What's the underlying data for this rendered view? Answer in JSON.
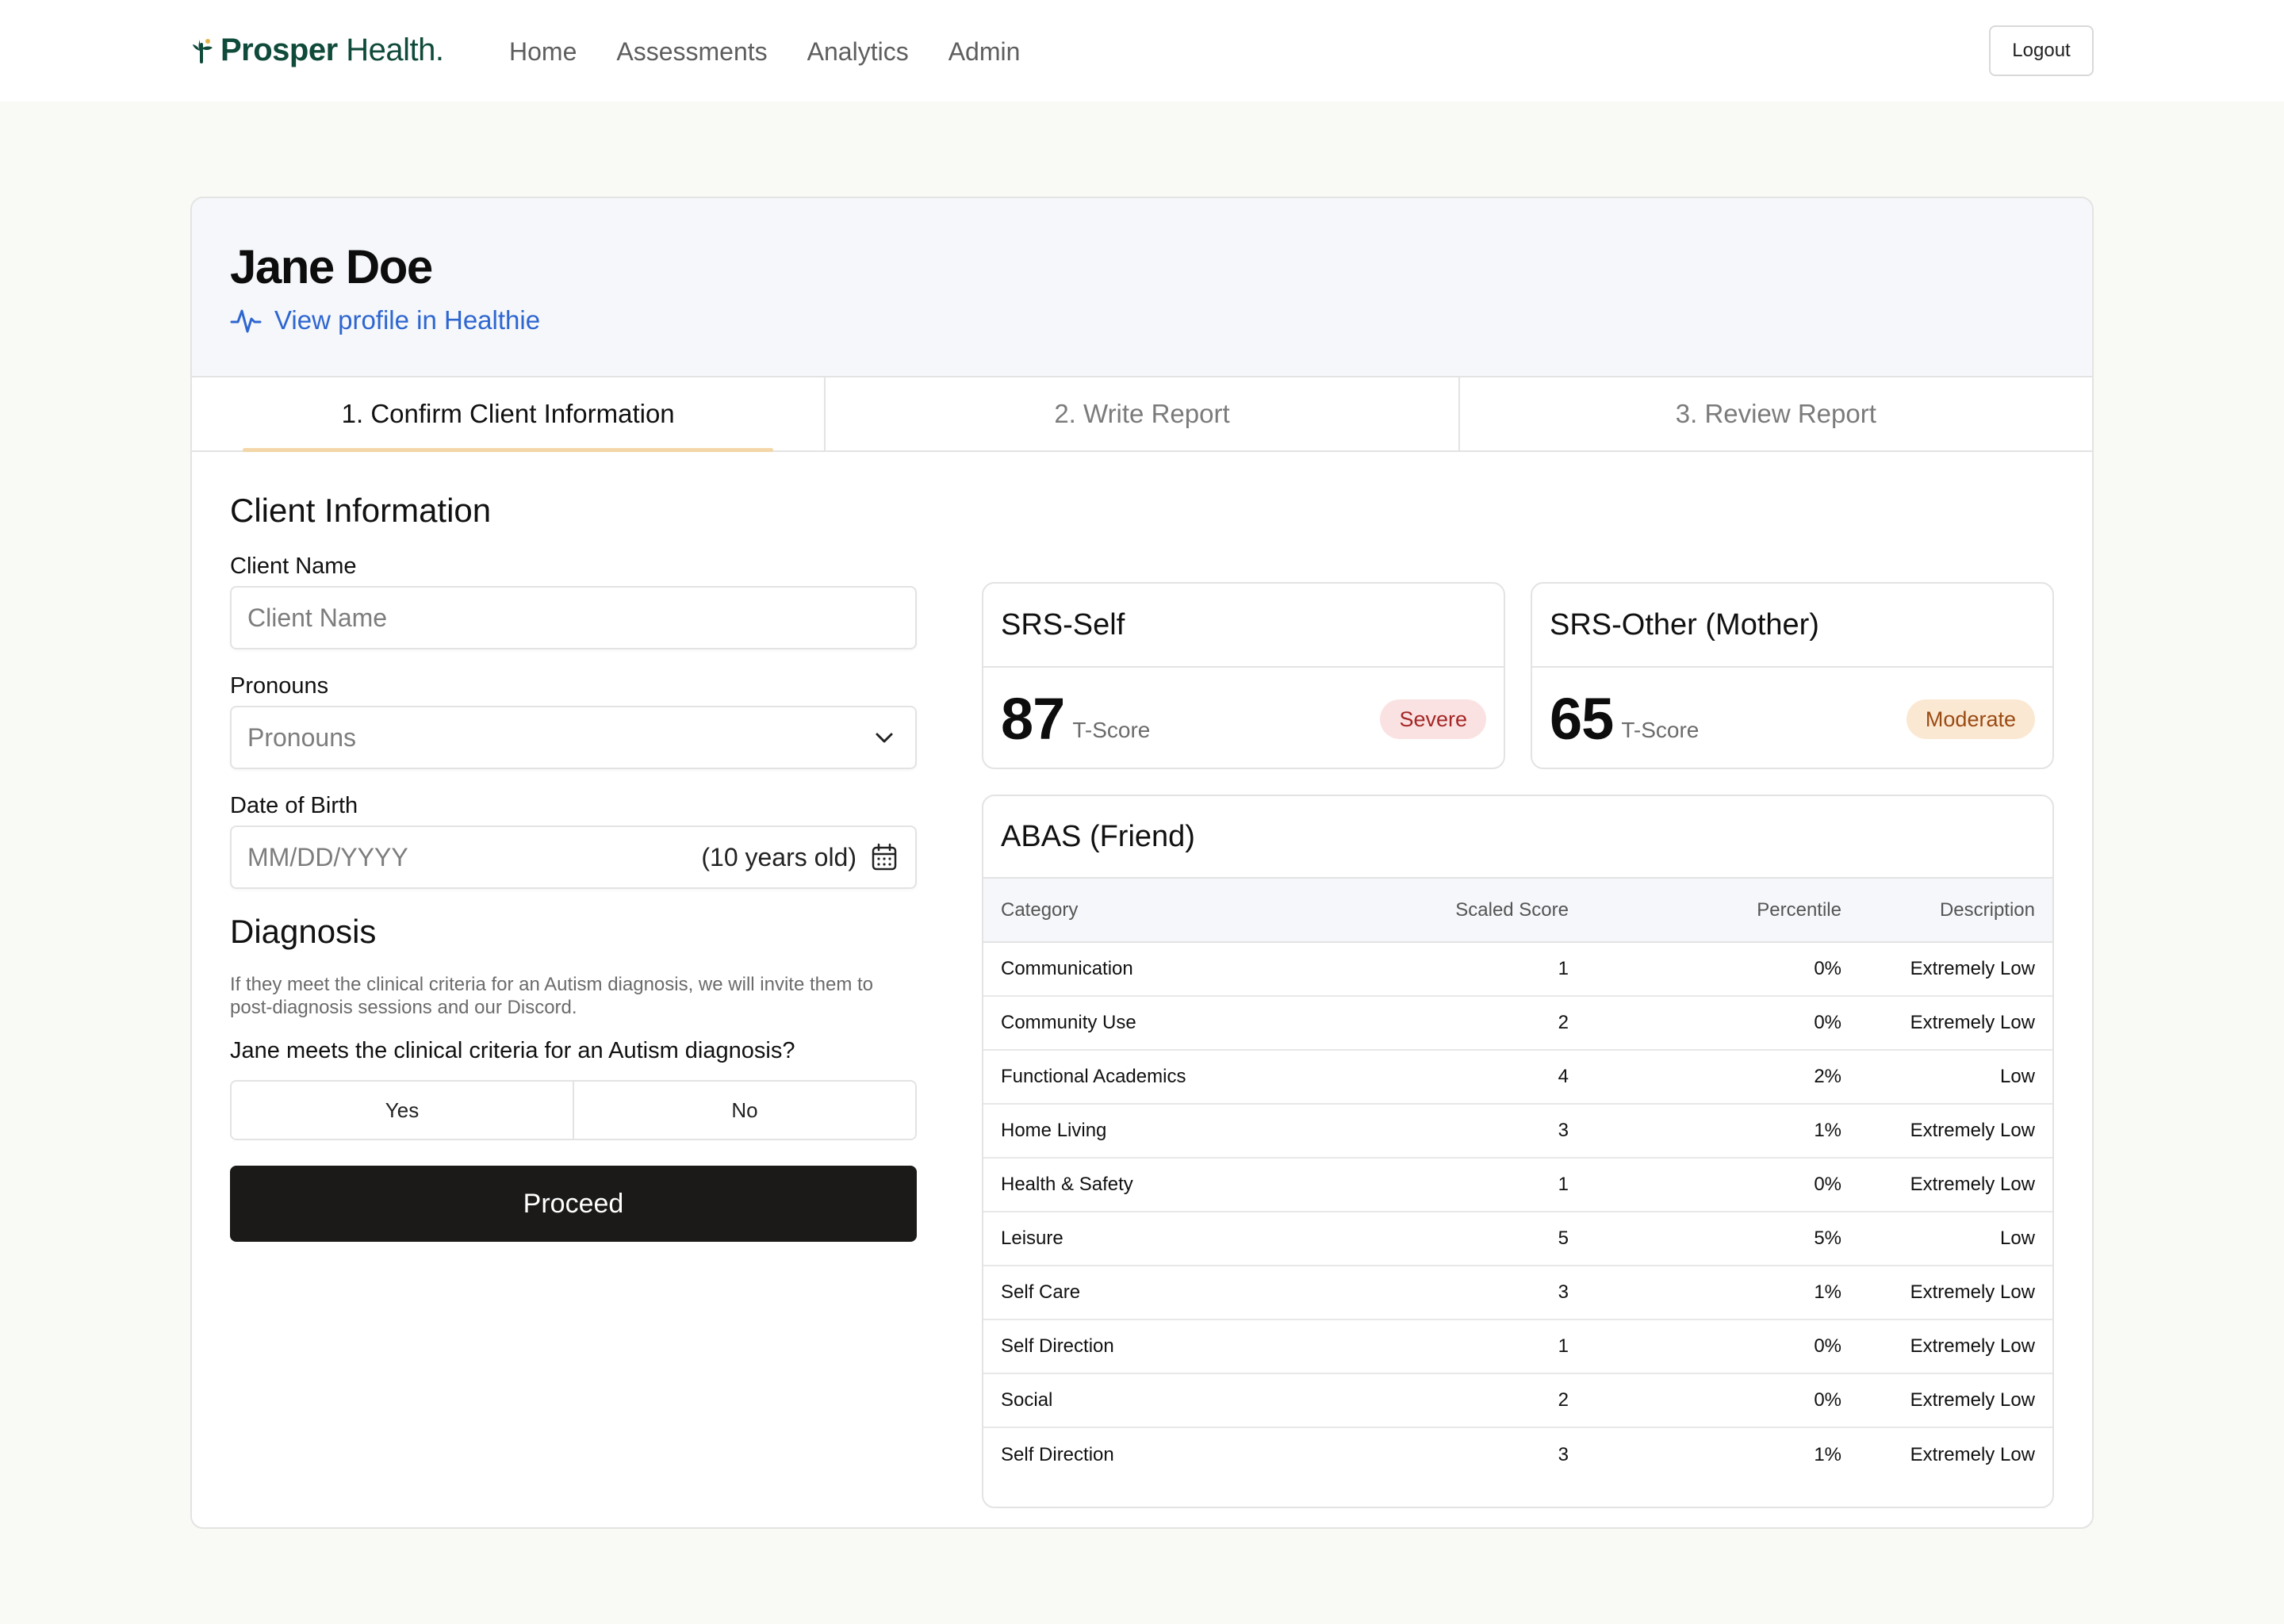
{
  "app": {
    "brand_bold": "Prosper",
    "brand_rest": " Health.",
    "nav": [
      "Home",
      "Assessments",
      "Analytics",
      "Admin"
    ],
    "logout_label": "Logout"
  },
  "client": {
    "name": "Jane Doe",
    "profile_link": "View profile in Healthie"
  },
  "steps": [
    {
      "label": "1. Confirm Client Information",
      "active": true
    },
    {
      "label": "2. Write Report",
      "active": false
    },
    {
      "label": "3. Review Report",
      "active": false
    }
  ],
  "form": {
    "section_title": "Client Information",
    "client_name_label": "Client Name",
    "client_name_placeholder": "Client Name",
    "pronouns_label": "Pronouns",
    "pronouns_placeholder": "Pronouns",
    "dob_label": "Date of Birth",
    "dob_placeholder": "MM/DD/YYYY",
    "dob_age": "(10 years old)",
    "diagnosis_title": "Diagnosis",
    "diagnosis_help": "If they meet the clinical criteria for an Autism diagnosis, we will invite them to post-diagnosis sessions and our Discord.",
    "diagnosis_question": "Jane meets the clinical criteria for an Autism diagnosis?",
    "yes_label": "Yes",
    "no_label": "No",
    "proceed_label": "Proceed"
  },
  "scores": [
    {
      "title": "SRS-Self",
      "value": "87",
      "unit": "T-Score",
      "level": "Severe",
      "level_color": "#a42727"
    },
    {
      "title": "SRS-Other (Mother)",
      "value": "65",
      "unit": "T-Score",
      "level": "Moderate",
      "level_color": "#9a4a13"
    }
  ],
  "abas": {
    "title": "ABAS (Friend)",
    "columns": [
      "Category",
      "Scaled Score",
      "Percentile",
      "Description"
    ],
    "rows": [
      [
        "Communication",
        "1",
        "0%",
        "Extremely Low"
      ],
      [
        "Community Use",
        "2",
        "0%",
        "Extremely Low"
      ],
      [
        "Functional Academics",
        "4",
        "2%",
        "Low"
      ],
      [
        "Home Living",
        "3",
        "1%",
        "Extremely Low"
      ],
      [
        "Health & Safety",
        "1",
        "0%",
        "Extremely Low"
      ],
      [
        "Leisure",
        "5",
        "5%",
        "Low"
      ],
      [
        "Self Care",
        "3",
        "1%",
        "Extremely Low"
      ],
      [
        "Self Direction",
        "1",
        "0%",
        "Extremely Low"
      ],
      [
        "Social",
        "2",
        "0%",
        "Extremely Low"
      ],
      [
        "Self Direction",
        "3",
        "1%",
        "Extremely Low"
      ]
    ]
  },
  "icons": {
    "logo": "prosper-leaf-icon",
    "profile": "activity-pulse-icon",
    "select": "chevron-down-icon",
    "date": "calendar-icon"
  },
  "colors": {
    "link": "#2e66d0",
    "active_tab_underline": "#f3d7a8",
    "brand": "#0f4a3a",
    "proceed_bg": "#1b1a18"
  }
}
